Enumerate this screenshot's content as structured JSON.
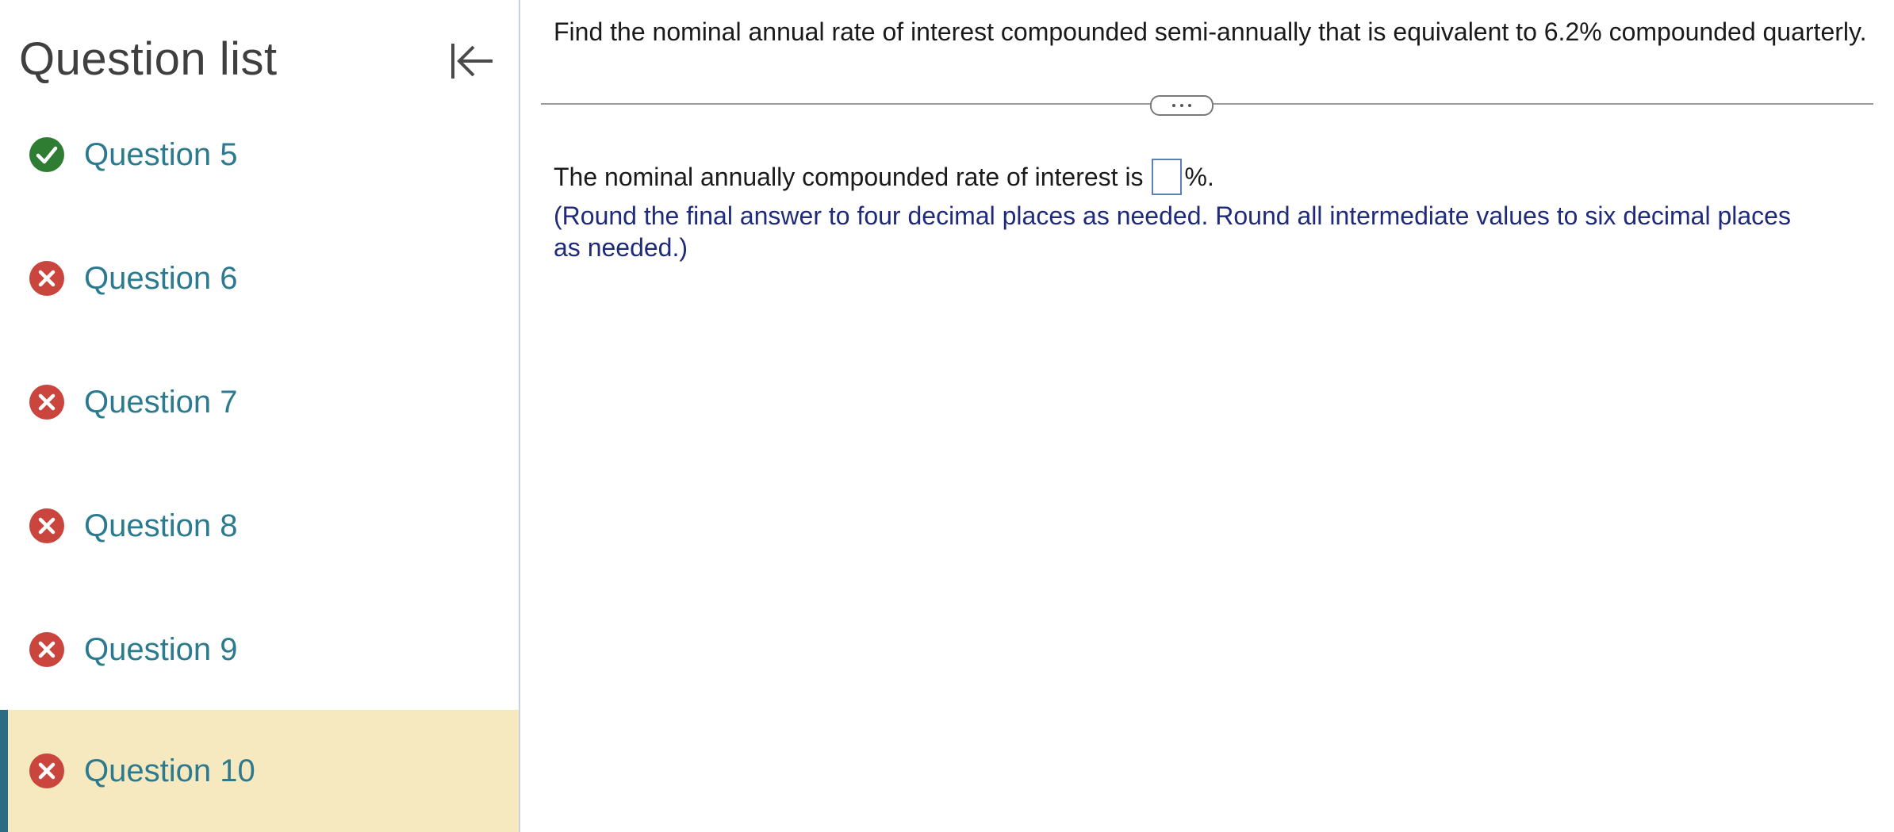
{
  "sidebar": {
    "title": "Question list",
    "collapse_icon": "collapse-left-icon",
    "items": [
      {
        "label": "Question 5",
        "status": "correct",
        "icon": "check-circle-icon"
      },
      {
        "label": "Question 6",
        "status": "incorrect",
        "icon": "x-circle-icon"
      },
      {
        "label": "Question 7",
        "status": "incorrect",
        "icon": "x-circle-icon"
      },
      {
        "label": "Question 8",
        "status": "incorrect",
        "icon": "x-circle-icon"
      },
      {
        "label": "Question 9",
        "status": "incorrect",
        "icon": "x-circle-icon"
      },
      {
        "label": "Question 10",
        "status": "incorrect",
        "icon": "x-circle-icon",
        "active": true
      }
    ]
  },
  "main": {
    "question": "Find the nominal annual rate of interest compounded semi-annually that is equivalent to 6.2% compounded quarterly.",
    "more_icon": "ellipsis-icon",
    "answer_prefix": "The nominal annually compounded rate of interest is",
    "answer_value": "",
    "answer_suffix": "%.",
    "instruction": "(Round the final answer to four decimal places as needed. Round all intermediate values to six decimal places as needed.)"
  },
  "colors": {
    "correct": "#2e7d32",
    "incorrect": "#c9453d",
    "link": "#2b7a90",
    "active_bg": "#f6e9bf",
    "active_bar": "#2d6a83",
    "instruction": "#1f2a7a"
  }
}
